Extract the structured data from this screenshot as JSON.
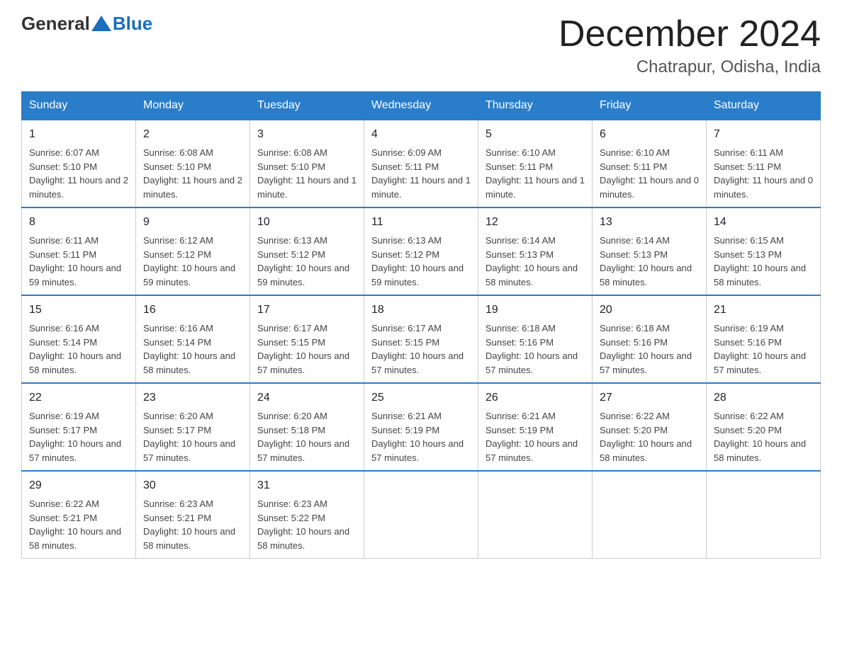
{
  "header": {
    "logo_general": "General",
    "logo_blue": "Blue",
    "month_title": "December 2024",
    "location": "Chatrapur, Odisha, India"
  },
  "days_of_week": [
    "Sunday",
    "Monday",
    "Tuesday",
    "Wednesday",
    "Thursday",
    "Friday",
    "Saturday"
  ],
  "weeks": [
    [
      {
        "day": "1",
        "sunrise": "6:07 AM",
        "sunset": "5:10 PM",
        "daylight": "11 hours and 2 minutes."
      },
      {
        "day": "2",
        "sunrise": "6:08 AM",
        "sunset": "5:10 PM",
        "daylight": "11 hours and 2 minutes."
      },
      {
        "day": "3",
        "sunrise": "6:08 AM",
        "sunset": "5:10 PM",
        "daylight": "11 hours and 1 minute."
      },
      {
        "day": "4",
        "sunrise": "6:09 AM",
        "sunset": "5:11 PM",
        "daylight": "11 hours and 1 minute."
      },
      {
        "day": "5",
        "sunrise": "6:10 AM",
        "sunset": "5:11 PM",
        "daylight": "11 hours and 1 minute."
      },
      {
        "day": "6",
        "sunrise": "6:10 AM",
        "sunset": "5:11 PM",
        "daylight": "11 hours and 0 minutes."
      },
      {
        "day": "7",
        "sunrise": "6:11 AM",
        "sunset": "5:11 PM",
        "daylight": "11 hours and 0 minutes."
      }
    ],
    [
      {
        "day": "8",
        "sunrise": "6:11 AM",
        "sunset": "5:11 PM",
        "daylight": "10 hours and 59 minutes."
      },
      {
        "day": "9",
        "sunrise": "6:12 AM",
        "sunset": "5:12 PM",
        "daylight": "10 hours and 59 minutes."
      },
      {
        "day": "10",
        "sunrise": "6:13 AM",
        "sunset": "5:12 PM",
        "daylight": "10 hours and 59 minutes."
      },
      {
        "day": "11",
        "sunrise": "6:13 AM",
        "sunset": "5:12 PM",
        "daylight": "10 hours and 59 minutes."
      },
      {
        "day": "12",
        "sunrise": "6:14 AM",
        "sunset": "5:13 PM",
        "daylight": "10 hours and 58 minutes."
      },
      {
        "day": "13",
        "sunrise": "6:14 AM",
        "sunset": "5:13 PM",
        "daylight": "10 hours and 58 minutes."
      },
      {
        "day": "14",
        "sunrise": "6:15 AM",
        "sunset": "5:13 PM",
        "daylight": "10 hours and 58 minutes."
      }
    ],
    [
      {
        "day": "15",
        "sunrise": "6:16 AM",
        "sunset": "5:14 PM",
        "daylight": "10 hours and 58 minutes."
      },
      {
        "day": "16",
        "sunrise": "6:16 AM",
        "sunset": "5:14 PM",
        "daylight": "10 hours and 58 minutes."
      },
      {
        "day": "17",
        "sunrise": "6:17 AM",
        "sunset": "5:15 PM",
        "daylight": "10 hours and 57 minutes."
      },
      {
        "day": "18",
        "sunrise": "6:17 AM",
        "sunset": "5:15 PM",
        "daylight": "10 hours and 57 minutes."
      },
      {
        "day": "19",
        "sunrise": "6:18 AM",
        "sunset": "5:16 PM",
        "daylight": "10 hours and 57 minutes."
      },
      {
        "day": "20",
        "sunrise": "6:18 AM",
        "sunset": "5:16 PM",
        "daylight": "10 hours and 57 minutes."
      },
      {
        "day": "21",
        "sunrise": "6:19 AM",
        "sunset": "5:16 PM",
        "daylight": "10 hours and 57 minutes."
      }
    ],
    [
      {
        "day": "22",
        "sunrise": "6:19 AM",
        "sunset": "5:17 PM",
        "daylight": "10 hours and 57 minutes."
      },
      {
        "day": "23",
        "sunrise": "6:20 AM",
        "sunset": "5:17 PM",
        "daylight": "10 hours and 57 minutes."
      },
      {
        "day": "24",
        "sunrise": "6:20 AM",
        "sunset": "5:18 PM",
        "daylight": "10 hours and 57 minutes."
      },
      {
        "day": "25",
        "sunrise": "6:21 AM",
        "sunset": "5:19 PM",
        "daylight": "10 hours and 57 minutes."
      },
      {
        "day": "26",
        "sunrise": "6:21 AM",
        "sunset": "5:19 PM",
        "daylight": "10 hours and 57 minutes."
      },
      {
        "day": "27",
        "sunrise": "6:22 AM",
        "sunset": "5:20 PM",
        "daylight": "10 hours and 58 minutes."
      },
      {
        "day": "28",
        "sunrise": "6:22 AM",
        "sunset": "5:20 PM",
        "daylight": "10 hours and 58 minutes."
      }
    ],
    [
      {
        "day": "29",
        "sunrise": "6:22 AM",
        "sunset": "5:21 PM",
        "daylight": "10 hours and 58 minutes."
      },
      {
        "day": "30",
        "sunrise": "6:23 AM",
        "sunset": "5:21 PM",
        "daylight": "10 hours and 58 minutes."
      },
      {
        "day": "31",
        "sunrise": "6:23 AM",
        "sunset": "5:22 PM",
        "daylight": "10 hours and 58 minutes."
      },
      null,
      null,
      null,
      null
    ]
  ]
}
